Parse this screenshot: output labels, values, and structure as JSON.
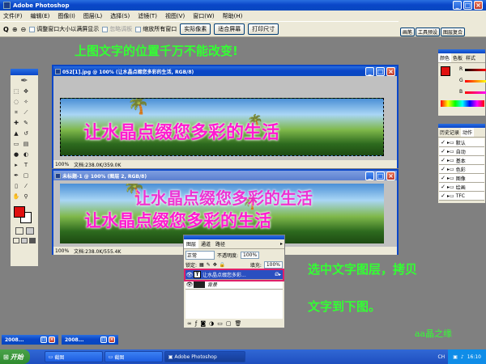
{
  "app": {
    "title": "Adobe Photoshop"
  },
  "menu": [
    "文件(F)",
    "编辑(E)",
    "图像(I)",
    "图层(L)",
    "选择(S)",
    "滤镜(T)",
    "视图(V)",
    "窗口(W)",
    "帮助(H)"
  ],
  "options": {
    "zoom_label": "Q",
    "check1": "调整窗口大小以满屏显示",
    "check2": "忽略调板",
    "check3": "缩放所有窗口",
    "btn_actual": "实际像素",
    "btn_fit": "适合屏幕",
    "btn_print": "打印尺寸"
  },
  "palette_well": [
    "画笔",
    "工具预设",
    "图层复合"
  ],
  "annotation_top": "上图文字的位置千万不能改变!",
  "annotation_right_1": "选中文字图层，拷贝",
  "annotation_right_2": "文字到下图。",
  "signature": "aa晶之缘",
  "doc1": {
    "title": "052[1].jpg @ 100% (让水晶点缀您多彩的生活, RGB/8)",
    "text": "让水晶点缀您多彩的生活",
    "zoom": "100%",
    "doc_info": "文档:238.0K/359.0K"
  },
  "doc2": {
    "title": "未标题-1 @ 100% (图层 2, RGB/8)",
    "text_a": "让水晶点缀您多彩的生活",
    "text_b": "让水晶点缀您多彩的生活",
    "zoom": "100%",
    "doc_info": "文档:238.0K/555.4K"
  },
  "color_panel": {
    "tabs": [
      "颜色",
      "色板",
      "样式"
    ],
    "r": "R",
    "g": "G",
    "b": "B"
  },
  "history_panel": {
    "tabs": [
      "历史记录",
      "动作"
    ],
    "items": [
      "默认",
      "自动",
      "基本",
      "色彩",
      "图像",
      "绘画",
      "TFC"
    ]
  },
  "layers_panel": {
    "tabs": [
      "图层",
      "通道",
      "路径"
    ],
    "blend": "正常",
    "opacity_label": "不透明度:",
    "opacity": "100%",
    "lock_label": "锁定:",
    "fill_label": "填充:",
    "fill": "100%",
    "layers": [
      {
        "name": "让水晶点缀您多彩...",
        "type": "T",
        "selected": true
      },
      {
        "name": "背景",
        "type": "img",
        "selected": false
      }
    ]
  },
  "minimized": [
    {
      "label": "2008..."
    },
    {
      "label": "2008..."
    }
  ],
  "taskbar": {
    "start": "开始",
    "items": [
      "截图",
      "截图",
      "Adobe Photoshop"
    ],
    "tray_lang": "CH",
    "clock": "16:10"
  },
  "colors": {
    "foreground": "#e01010",
    "accent_text": "#ff1ad0",
    "note": "#33ff33"
  }
}
